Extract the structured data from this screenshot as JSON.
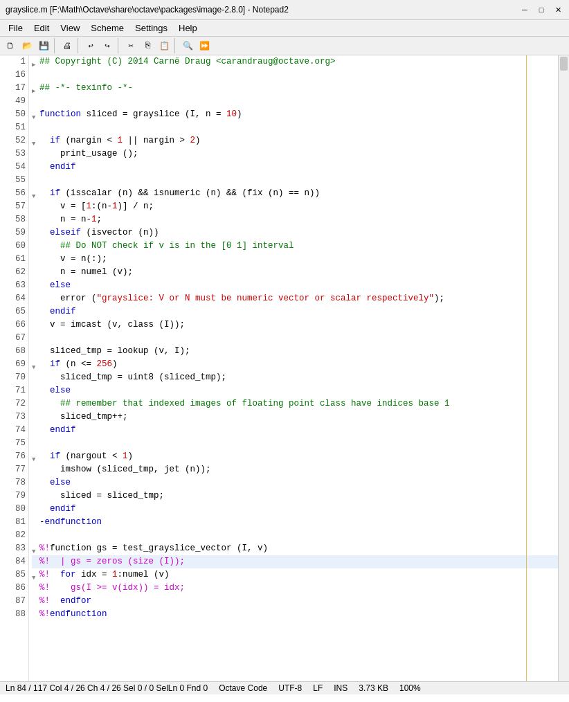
{
  "titlebar": {
    "title": "grayslice.m [F:\\Math\\Octave\\share\\octave\\packages\\image-2.8.0] - Notepad2",
    "min_label": "─",
    "max_label": "□",
    "close_label": "✕"
  },
  "menubar": {
    "items": [
      "File",
      "Edit",
      "View",
      "Scheme",
      "Settings",
      "Help"
    ]
  },
  "statusbar": {
    "position": "Ln 84 / 117  Col 4 / 26  Ch 4 / 26  Sel 0 / 0  SelLn 0  Fnd 0",
    "mode": "Octave Code",
    "encoding": "UTF-8",
    "eol": "LF",
    "ins": "INS",
    "size": "3.73 KB",
    "zoom": "100%"
  },
  "lines": [
    {
      "num": "1",
      "fold": "▶",
      "tokens": [
        {
          "t": "## Copyright (C) 2014 Carnë Draug <carandraug@octave.org>",
          "c": "cmt"
        }
      ]
    },
    {
      "num": "16",
      "fold": "",
      "tokens": []
    },
    {
      "num": "17",
      "fold": "▶",
      "tokens": [
        {
          "t": "## -*- texinfo -*-",
          "c": "cmt"
        }
      ]
    },
    {
      "num": "49",
      "fold": "",
      "tokens": []
    },
    {
      "num": "50",
      "fold": "▼",
      "tokens": [
        {
          "t": "function ",
          "c": "kw"
        },
        {
          "t": "sliced = grayslice (I, n = ",
          "c": "code-normal"
        },
        {
          "t": "10",
          "c": "num"
        },
        {
          "t": ")",
          "c": "code-normal"
        }
      ]
    },
    {
      "num": "51",
      "fold": "",
      "tokens": []
    },
    {
      "num": "52",
      "fold": "▼",
      "tokens": [
        {
          "t": "  ",
          "c": "code-normal"
        },
        {
          "t": "if",
          "c": "kw"
        },
        {
          "t": " (nargin < ",
          "c": "code-normal"
        },
        {
          "t": "1",
          "c": "num"
        },
        {
          "t": " || nargin > ",
          "c": "code-normal"
        },
        {
          "t": "2",
          "c": "num"
        },
        {
          "t": ")",
          "c": "code-normal"
        }
      ]
    },
    {
      "num": "53",
      "fold": "",
      "tokens": [
        {
          "t": "    print_usage ();",
          "c": "code-normal"
        }
      ]
    },
    {
      "num": "54",
      "fold": "",
      "tokens": [
        {
          "t": "  ",
          "c": "code-normal"
        },
        {
          "t": "endif",
          "c": "kw"
        }
      ]
    },
    {
      "num": "55",
      "fold": "",
      "tokens": []
    },
    {
      "num": "56",
      "fold": "▼",
      "tokens": [
        {
          "t": "  ",
          "c": "code-normal"
        },
        {
          "t": "if",
          "c": "kw"
        },
        {
          "t": " (isscalar (n) && isnumeric (n) && (fix (n) == n))",
          "c": "code-normal"
        }
      ]
    },
    {
      "num": "57",
      "fold": "",
      "tokens": [
        {
          "t": "    v = [",
          "c": "code-normal"
        },
        {
          "t": "1",
          "c": "num"
        },
        {
          "t": ":(n-",
          "c": "code-normal"
        },
        {
          "t": "1",
          "c": "num"
        },
        {
          "t": ")] / n;",
          "c": "code-normal"
        }
      ]
    },
    {
      "num": "58",
      "fold": "",
      "tokens": [
        {
          "t": "    n = n-",
          "c": "code-normal"
        },
        {
          "t": "1",
          "c": "num"
        },
        {
          "t": ";",
          "c": "code-normal"
        }
      ]
    },
    {
      "num": "59",
      "fold": "",
      "tokens": [
        {
          "t": "  ",
          "c": "code-normal"
        },
        {
          "t": "elseif",
          "c": "kw"
        },
        {
          "t": " (isvector (n))",
          "c": "code-normal"
        }
      ]
    },
    {
      "num": "60",
      "fold": "",
      "tokens": [
        {
          "t": "    ## Do NOT check if v is in the [0 1] interval",
          "c": "cmt"
        }
      ]
    },
    {
      "num": "61",
      "fold": "",
      "tokens": [
        {
          "t": "    v = n(:);",
          "c": "code-normal"
        }
      ]
    },
    {
      "num": "62",
      "fold": "",
      "tokens": [
        {
          "t": "    n = numel (v);",
          "c": "code-normal"
        }
      ]
    },
    {
      "num": "63",
      "fold": "",
      "tokens": [
        {
          "t": "  ",
          "c": "code-normal"
        },
        {
          "t": "else",
          "c": "kw"
        }
      ]
    },
    {
      "num": "64",
      "fold": "",
      "tokens": [
        {
          "t": "    error (",
          "c": "code-normal"
        },
        {
          "t": "\"grayslice: V or N must be numeric vector or scalar respectively\"",
          "c": "str"
        },
        {
          "t": ");",
          "c": "code-normal"
        }
      ]
    },
    {
      "num": "65",
      "fold": "",
      "tokens": [
        {
          "t": "  ",
          "c": "code-normal"
        },
        {
          "t": "endif",
          "c": "kw"
        }
      ]
    },
    {
      "num": "66",
      "fold": "",
      "tokens": [
        {
          "t": "  v = imcast (v, class (I));",
          "c": "code-normal"
        }
      ]
    },
    {
      "num": "67",
      "fold": "",
      "tokens": []
    },
    {
      "num": "68",
      "fold": "",
      "tokens": [
        {
          "t": "  sliced_tmp = lookup (v, I);",
          "c": "code-normal"
        }
      ]
    },
    {
      "num": "69",
      "fold": "▼",
      "tokens": [
        {
          "t": "  ",
          "c": "code-normal"
        },
        {
          "t": "if",
          "c": "kw"
        },
        {
          "t": " (n <= ",
          "c": "code-normal"
        },
        {
          "t": "256",
          "c": "num"
        },
        {
          "t": ")",
          "c": "code-normal"
        }
      ]
    },
    {
      "num": "70",
      "fold": "",
      "tokens": [
        {
          "t": "    sliced_tmp = uint8 (sliced_tmp);",
          "c": "code-normal"
        }
      ]
    },
    {
      "num": "71",
      "fold": "",
      "tokens": [
        {
          "t": "  ",
          "c": "code-normal"
        },
        {
          "t": "else",
          "c": "kw"
        }
      ]
    },
    {
      "num": "72",
      "fold": "",
      "tokens": [
        {
          "t": "    ## remember that indexed images of floating point class have indices base 1",
          "c": "cmt"
        }
      ]
    },
    {
      "num": "73",
      "fold": "",
      "tokens": [
        {
          "t": "    sliced_tmp++;",
          "c": "code-normal"
        }
      ]
    },
    {
      "num": "74",
      "fold": "",
      "tokens": [
        {
          "t": "  ",
          "c": "code-normal"
        },
        {
          "t": "endif",
          "c": "kw"
        }
      ]
    },
    {
      "num": "75",
      "fold": "",
      "tokens": []
    },
    {
      "num": "76",
      "fold": "▼",
      "tokens": [
        {
          "t": "  ",
          "c": "code-normal"
        },
        {
          "t": "if",
          "c": "kw"
        },
        {
          "t": " (nargout < ",
          "c": "code-normal"
        },
        {
          "t": "1",
          "c": "num"
        },
        {
          "t": ")",
          "c": "code-normal"
        }
      ]
    },
    {
      "num": "77",
      "fold": "",
      "tokens": [
        {
          "t": "    imshow (sliced_tmp, jet (n));",
          "c": "code-normal"
        }
      ]
    },
    {
      "num": "78",
      "fold": "",
      "tokens": [
        {
          "t": "  ",
          "c": "code-normal"
        },
        {
          "t": "else",
          "c": "kw"
        }
      ]
    },
    {
      "num": "79",
      "fold": "",
      "tokens": [
        {
          "t": "    sliced = sliced_tmp;",
          "c": "code-normal"
        }
      ]
    },
    {
      "num": "80",
      "fold": "",
      "tokens": [
        {
          "t": "  ",
          "c": "code-normal"
        },
        {
          "t": "endif",
          "c": "kw"
        }
      ]
    },
    {
      "num": "81",
      "fold": "",
      "tokens": [
        {
          "t": "-",
          "c": "code-normal"
        },
        {
          "t": "endfunction",
          "c": "kw"
        }
      ]
    },
    {
      "num": "82",
      "fold": "",
      "tokens": []
    },
    {
      "num": "83",
      "fold": "▼",
      "tokens": [
        {
          "t": "%!",
          "c": "pct"
        },
        {
          "t": "function gs = test_grayslice_vector (I, v)",
          "c": "code-normal"
        }
      ]
    },
    {
      "num": "84",
      "fold": "",
      "tokens": [
        {
          "t": "%!  | gs = zeros (size (I));",
          "c": "pct"
        },
        {
          "t": "",
          "c": "code-normal"
        }
      ],
      "active": true
    },
    {
      "num": "85",
      "fold": "▼",
      "tokens": [
        {
          "t": "%!  ",
          "c": "pct"
        },
        {
          "t": "for",
          "c": "kw"
        },
        {
          "t": " idx = ",
          "c": "code-normal"
        },
        {
          "t": "1",
          "c": "num"
        },
        {
          "t": ":numel (v)",
          "c": "code-normal"
        }
      ]
    },
    {
      "num": "86",
      "fold": "",
      "tokens": [
        {
          "t": "%!    gs(I >= v(idx)) = idx;",
          "c": "pct"
        }
      ]
    },
    {
      "num": "87",
      "fold": "",
      "tokens": [
        {
          "t": "%!  ",
          "c": "pct"
        },
        {
          "t": "endfor",
          "c": "kw"
        }
      ]
    },
    {
      "num": "88",
      "fold": "",
      "tokens": [
        {
          "t": "%!",
          "c": "pct"
        },
        {
          "t": "endfunction",
          "c": "kw"
        }
      ]
    }
  ]
}
